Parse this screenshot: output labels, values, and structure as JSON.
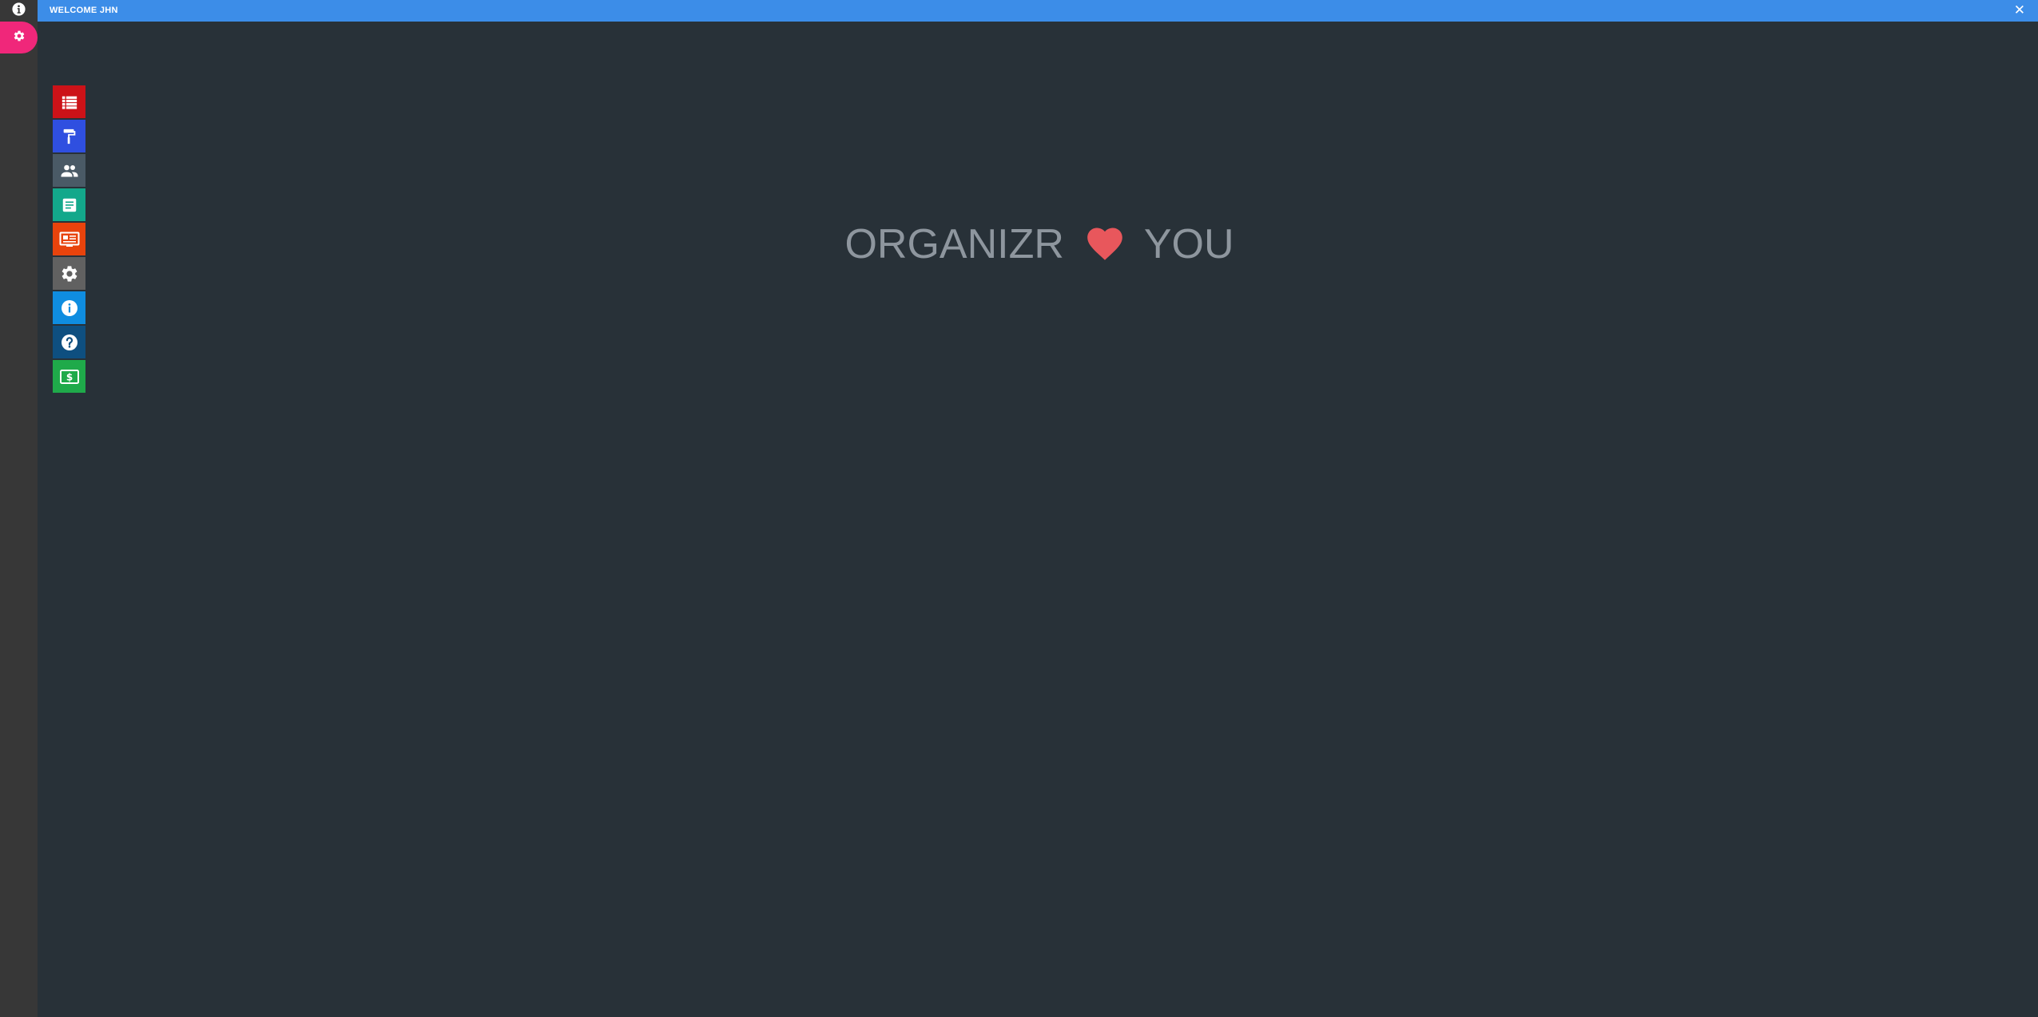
{
  "topbar": {
    "title": "WELCOME JHN",
    "close_glyph": "✕"
  },
  "rail": {
    "icons": [
      {
        "name": "info-circle-icon"
      },
      {
        "name": "gear-icon",
        "active": true,
        "color": "#f0277a"
      }
    ]
  },
  "tiles": [
    {
      "name": "table-list-icon",
      "color": "#cc1218"
    },
    {
      "name": "paint-roller-icon",
      "color": "#2f4fe0"
    },
    {
      "name": "users-icon",
      "color": "#4a5a66"
    },
    {
      "name": "document-icon",
      "color": "#13a88b"
    },
    {
      "name": "newspaper-icon",
      "color": "#e8430c"
    },
    {
      "name": "gear-icon",
      "color": "#616161"
    },
    {
      "name": "info-icon",
      "color": "#0f8de0"
    },
    {
      "name": "help-icon",
      "color": "#0e4f80"
    },
    {
      "name": "money-icon",
      "color": "#1faa4a"
    }
  ],
  "slogan": {
    "left": "ORGANIZR",
    "heart_icon": "heart-icon",
    "heart_color": "#e8575c",
    "right": "YOU"
  },
  "colors": {
    "background": "#283138",
    "rail": "#373737",
    "topbar": "#3c8de8"
  }
}
